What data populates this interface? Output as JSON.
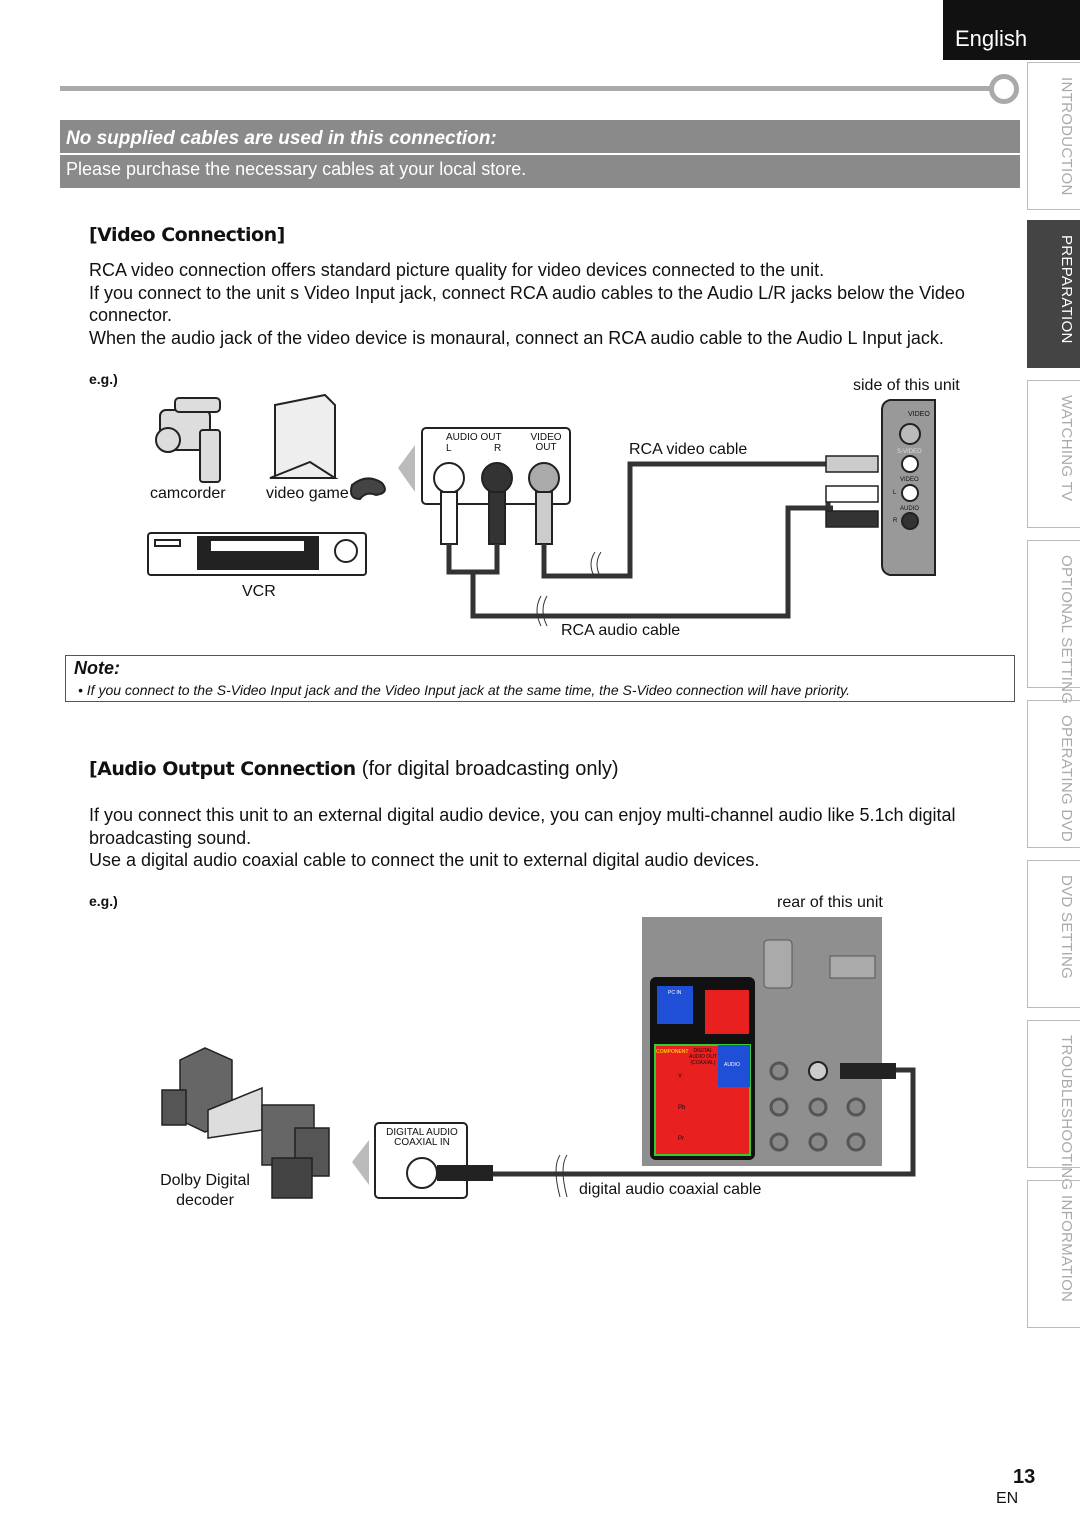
{
  "header": {
    "language": "English"
  },
  "banner": {
    "title": "No supplied cables are used in this connection:",
    "subtitle": "Please purchase the necessary cables at your local store."
  },
  "sidebar": {
    "tabs": [
      {
        "label": "INTRODUCTION",
        "active": false
      },
      {
        "label": "PREPARATION",
        "active": true
      },
      {
        "label": "WATCHING  TV",
        "active": false
      },
      {
        "label": "OPTIONAL  SETTING",
        "active": false
      },
      {
        "label": "OPERATING  DVD",
        "active": false
      },
      {
        "label": "DVD  SETTING",
        "active": false
      },
      {
        "label": "TROUBLESHOOTING",
        "active": false
      },
      {
        "label": "INFORMATION",
        "active": false
      }
    ]
  },
  "video": {
    "heading": "[Video Connection]",
    "p1": "RCA video connection offers standard picture quality for video devices connected to the unit.",
    "p2": "If you connect to the unit s Video Input jack, connect RCA audio cables to the Audio L/R jacks below the Video connector.",
    "p3": "When the audio jack of the video device is monaural, connect an RCA audio cable to the Audio L Input jack.",
    "eg": "e.g.)",
    "side_label": "side of this unit",
    "devices": {
      "camcorder": "camcorder",
      "video_game": "video game",
      "vcr": "VCR"
    },
    "panel": {
      "audio_out": "AUDIO OUT",
      "l": "L",
      "r": "R",
      "video_out": "VIDEO OUT"
    },
    "unit_panel": {
      "video": "VIDEO",
      "svideo": "S-VIDEO",
      "video_jack": "VIDEO",
      "audio": "AUDIO",
      "l": "L",
      "r": "R"
    },
    "rca_video_cable": "RCA video cable",
    "rca_audio_cable": "RCA audio cable"
  },
  "note": {
    "title": "Note:",
    "bullet": "If you connect to the S-Video Input jack and the Video Input jack at the same time, the S-Video connection will have priority."
  },
  "audio": {
    "heading": "[Audio Output Connection",
    "heading_sub": "(for digital broadcasting only)",
    "p1": "If you connect this unit to an external digital audio device, you can enjoy multi-channel audio like 5.1ch digital broadcasting sound.",
    "p2": "Use a digital audio coaxial cable to connect the unit to external digital audio devices.",
    "eg": "e.g.)",
    "rear_label": "rear of this unit",
    "decoder": "Dolby Digital decoder",
    "coax_in": "DIGITAL AUDIO COAXIAL IN",
    "cable": "digital audio coaxial cable",
    "rear_panel": {
      "pc_in": "PC IN",
      "component": "COMPONENT",
      "digital_out": "DIGITAL AUDIO OUT (COAXIAL)",
      "audio": "AUDIO",
      "y": "Y",
      "pb": "Pb",
      "pr": "Pr"
    }
  },
  "footer": {
    "page": "13",
    "lang": "EN"
  }
}
